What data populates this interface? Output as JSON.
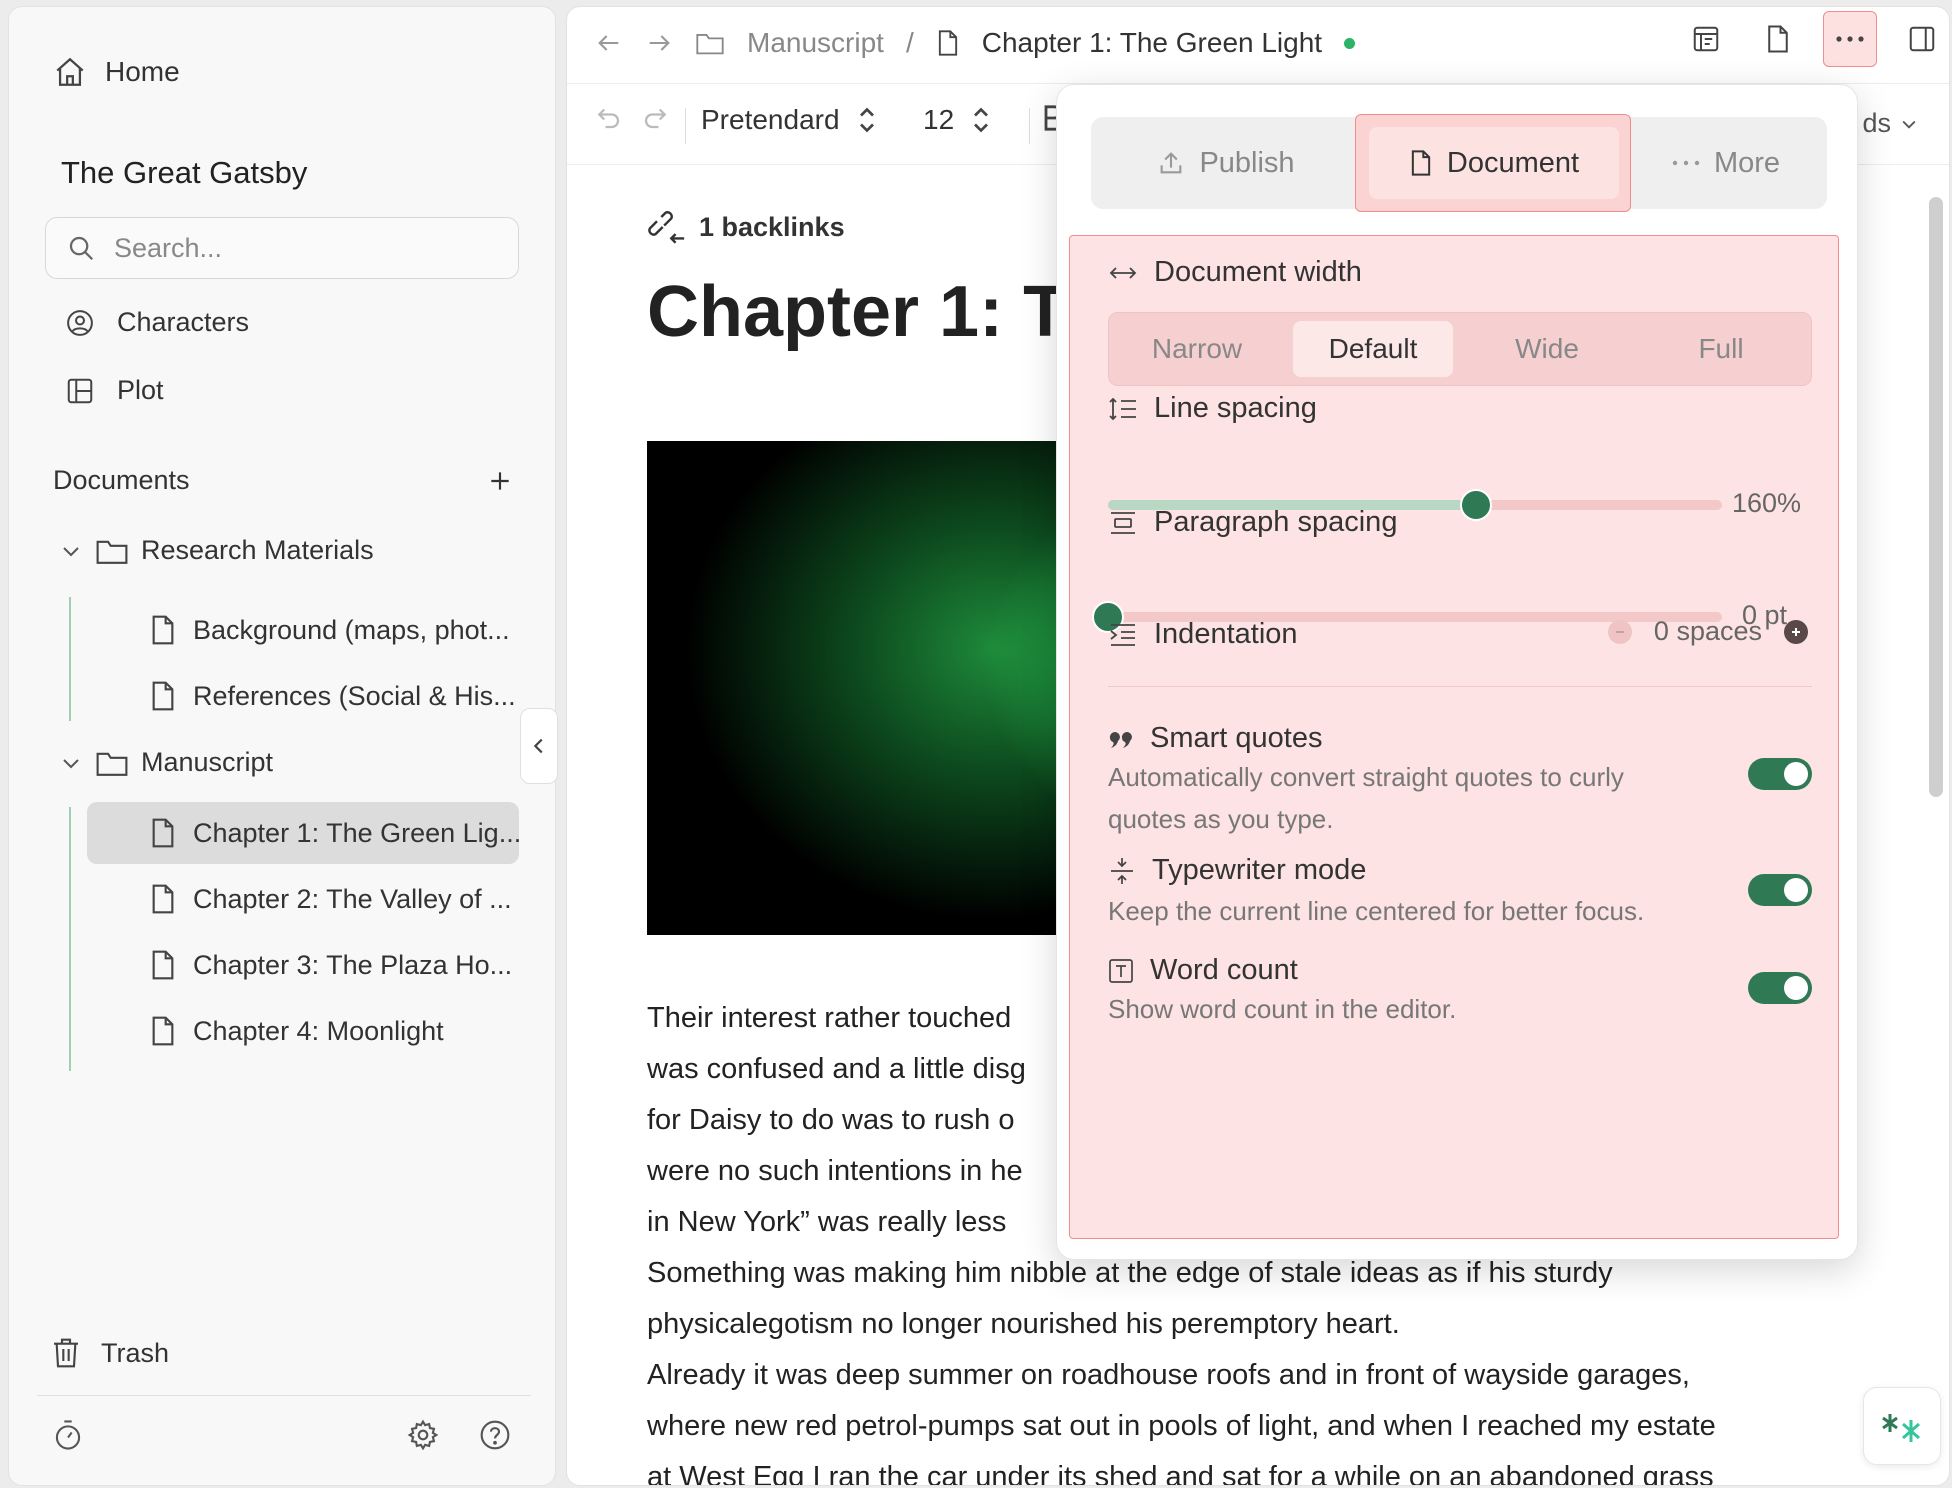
{
  "sidebar": {
    "home_label": "Home",
    "project_title": "The Great Gatsby",
    "search_placeholder": "Search...",
    "links": [
      {
        "label": "Characters",
        "icon": "user-circle-icon"
      },
      {
        "label": "Plot",
        "icon": "layout-icon"
      }
    ],
    "documents_label": "Documents",
    "folders": [
      {
        "label": "Research Materials",
        "docs": [
          "Background (maps, phot...",
          "References (Social & His..."
        ]
      },
      {
        "label": "Manuscript",
        "docs": [
          "Chapter 1: The Green Lig...",
          "Chapter 2: The Valley of ...",
          "Chapter 3: The Plaza Ho...",
          "Chapter 4: Moonlight"
        ]
      }
    ],
    "trash_label": "Trash"
  },
  "breadcrumb": {
    "folder": "Manuscript",
    "separator": "/",
    "document": "Chapter 1: The Green Light"
  },
  "toolbar": {
    "font": "Pretendard",
    "size": "12",
    "right_label": "ds"
  },
  "doc": {
    "backlinks": "1 backlinks",
    "title": "Chapter 1: Th",
    "paragraphs": [
      "Their interest rather touched",
      "was confused and a little disg",
      "for Daisy to do was to rush o",
      "were no such intentions in he",
      "in New York” was really less",
      "Something was making him nibble at the edge of stale ideas as if his sturdy",
      "physicalegotism no longer nourished his peremptory heart.",
      "Already it was deep summer on roadhouse roofs and in front of wayside garages,",
      "where new red petrol-pumps sat out in pools of light, and when I reached my estate",
      "at West Egg I ran the car under its shed and sat for a while on an abandoned grass"
    ]
  },
  "popover": {
    "tabs": {
      "publish": "Publish",
      "document": "Document",
      "more": "More"
    },
    "document_width": {
      "title": "Document width",
      "options": [
        "Narrow",
        "Default",
        "Wide",
        "Full"
      ],
      "selected": "Default"
    },
    "line_spacing": {
      "title": "Line spacing",
      "value_text": "160%",
      "level": 0.6
    },
    "paragraph_spacing": {
      "title": "Paragraph spacing",
      "value_text": "0 pt",
      "level": 0.0
    },
    "indentation": {
      "title": "Indentation",
      "value_text": "0 spaces"
    },
    "smart_quotes": {
      "title": "Smart quotes",
      "desc": "Automatically convert straight quotes to curly quotes as you type.",
      "on": true
    },
    "typewriter": {
      "title": "Typewriter mode",
      "desc": "Keep the current line centered for better focus.",
      "on": true
    },
    "word_count": {
      "title": "Word count",
      "desc": "Show word count in the editor.",
      "on": true
    }
  },
  "colors": {
    "accent_green": "#2f7a55",
    "status_green": "#2bb36a",
    "highlight_pink": "#fde3e3",
    "highlight_border": "#f08e8e"
  }
}
